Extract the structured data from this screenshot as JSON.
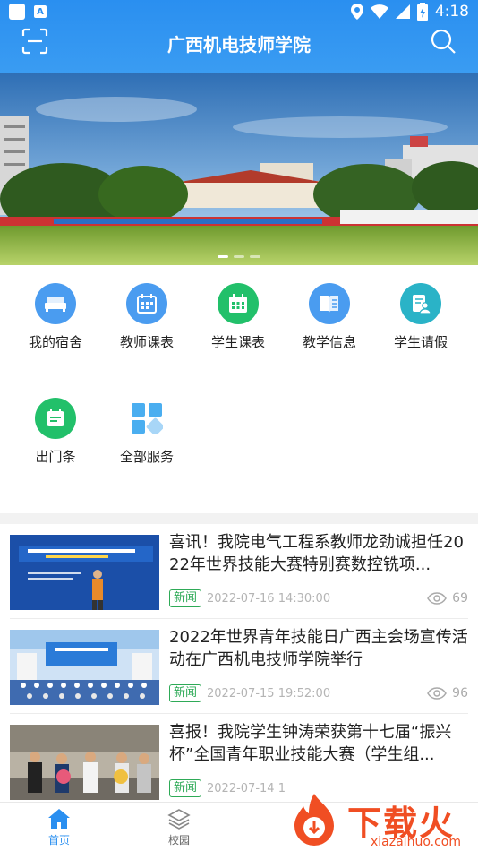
{
  "status_bar": {
    "time": "4:18"
  },
  "header": {
    "title": "广西机电技师学院"
  },
  "services": [
    {
      "label": "我的宿舍",
      "icon": "bed-icon",
      "color": "#4a9cf0"
    },
    {
      "label": "教师课表",
      "icon": "calendar-icon",
      "color": "#4a9cf0"
    },
    {
      "label": "学生课表",
      "icon": "calendar-grid-icon",
      "color": "#22c06a"
    },
    {
      "label": "教学信息",
      "icon": "book-icon",
      "color": "#4a9cf0"
    },
    {
      "label": "学生请假",
      "icon": "leave-request-icon",
      "color": "#2ab3c7"
    },
    {
      "label": "出门条",
      "icon": "pass-slip-icon",
      "color": "#22c06a"
    },
    {
      "label": "全部服务",
      "icon": "all-services-icon",
      "color": "#4aaef0"
    }
  ],
  "news": [
    {
      "title": "喜讯！我院电气工程系教师龙劲诚担任2022年世界技能大赛特别赛数控铣项...",
      "tag": "新闻",
      "date": "2022-07-16 14:30:00",
      "views": "69"
    },
    {
      "title": "2022年世界青年技能日广西主会场宣传活动在广西机电技师学院举行",
      "tag": "新闻",
      "date": "2022-07-15 19:52:00",
      "views": "96"
    },
    {
      "title": "喜报！我院学生钟涛荣获第十七届“振兴杯”全国青年职业技能大赛（学生组...",
      "tag": "新闻",
      "date": "2022-07-14 1"
    }
  ],
  "bottom_nav": [
    {
      "label": "首页",
      "active": true
    },
    {
      "label": "校园",
      "active": false
    }
  ],
  "watermark": {
    "text": "下载火",
    "url": "xiazaihuo.com"
  },
  "colors": {
    "primary": "#2a8ff0",
    "green": "#2eaa57"
  }
}
